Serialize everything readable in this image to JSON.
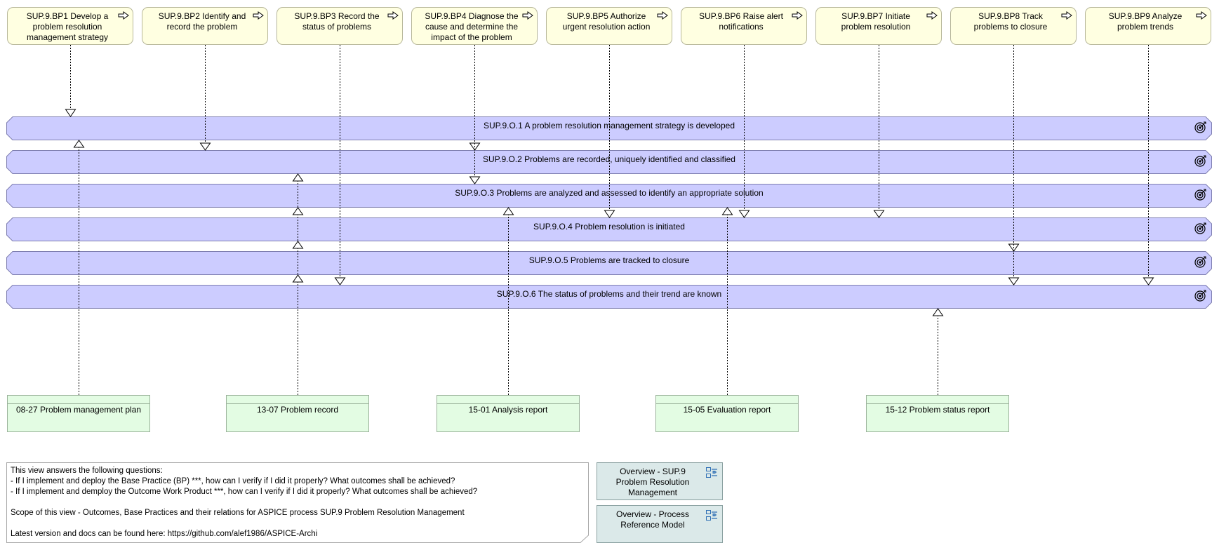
{
  "base_practices": [
    {
      "id": "bp1",
      "label": "SUP.9.BP1 Develop a problem resolution management strategy"
    },
    {
      "id": "bp2",
      "label": "SUP.9.BP2 Identify and record the problem"
    },
    {
      "id": "bp3",
      "label": "SUP.9.BP3 Record the status of problems"
    },
    {
      "id": "bp4",
      "label": "SUP.9.BP4 Diagnose the cause and determine the impact of the problem"
    },
    {
      "id": "bp5",
      "label": "SUP.9.BP5 Authorize urgent resolution action"
    },
    {
      "id": "bp6",
      "label": "SUP.9.BP6 Raise alert notifications"
    },
    {
      "id": "bp7",
      "label": "SUP.9.BP7 Initiate problem resolution"
    },
    {
      "id": "bp8",
      "label": "SUP.9.BP8 Track problems to closure"
    },
    {
      "id": "bp9",
      "label": "SUP.9.BP9 Analyze problem trends"
    }
  ],
  "outcomes": [
    {
      "id": "o1",
      "label": "SUP.9.O.1 A problem resolution management strategy is developed"
    },
    {
      "id": "o2",
      "label": "SUP.9.O.2 Problems are recorded, uniquely identified and classified"
    },
    {
      "id": "o3",
      "label": "SUP.9.O.3 Problems are analyzed and assessed to identify an appropriate solution"
    },
    {
      "id": "o4",
      "label": "SUP.9.O.4 Problem resolution is initiated"
    },
    {
      "id": "o5",
      "label": "SUP.9.O.5 Problems are tracked to closure"
    },
    {
      "id": "o6",
      "label": "SUP.9.O.6 The status of problems and their trend are known"
    }
  ],
  "work_products": [
    {
      "id": "wp0827",
      "label": "08-27 Problem management plan"
    },
    {
      "id": "wp1307",
      "label": "13-07 Problem record"
    },
    {
      "id": "wp1501",
      "label": "15-01 Analysis report"
    },
    {
      "id": "wp1505",
      "label": "15-05 Evaluation report"
    },
    {
      "id": "wp1512",
      "label": "15-12 Problem status report"
    }
  ],
  "relations": {
    "bp_to_outcome": [
      [
        "bp1",
        "o1"
      ],
      [
        "bp2",
        "o2"
      ],
      [
        "bp3",
        "o6"
      ],
      [
        "bp4",
        "o2"
      ],
      [
        "bp4",
        "o3"
      ],
      [
        "bp5",
        "o4"
      ],
      [
        "bp6",
        "o4"
      ],
      [
        "bp7",
        "o4"
      ],
      [
        "bp8",
        "o5"
      ],
      [
        "bp8",
        "o6"
      ],
      [
        "bp9",
        "o6"
      ]
    ],
    "wp_to_outcome": [
      [
        "wp0827",
        "o1"
      ],
      [
        "wp1307",
        "o2"
      ],
      [
        "wp1307",
        "o3"
      ],
      [
        "wp1307",
        "o4"
      ],
      [
        "wp1307",
        "o5"
      ],
      [
        "wp1501",
        "o3"
      ],
      [
        "wp1505",
        "o3"
      ],
      [
        "wp1512",
        "o6"
      ]
    ]
  },
  "note": {
    "text": "This view answers the following questions:\n- If I implement and deploy the Base Practice (BP) ***, how can I verify if I did it properly? What outcomes shall be achieved?\n- If I implement and demploy the Outcome Work Product ***, how can I verify if I did it properly? What outcomes shall be achieved?\n\nScope of this view - Outcomes, Base Practices and their relations for ASPICE process SUP.9 Problem Resolution Management\n\nLatest version and docs can be found here: https://github.com/alef1986/ASPICE-Archi"
  },
  "view_references": [
    {
      "label": "Overview - SUP.9 Problem Resolution Management",
      "icon": "view-reference-icon"
    },
    {
      "label": "Overview - Process Reference Model",
      "icon": "view-reference-icon"
    }
  ],
  "colors": {
    "bp_fill": "#ffffe1",
    "outcome_fill": "#ccccff",
    "outcome_border": "#7f7fb0",
    "wp_fill": "#e3fce3",
    "ref_fill": "#dbe9e9"
  }
}
